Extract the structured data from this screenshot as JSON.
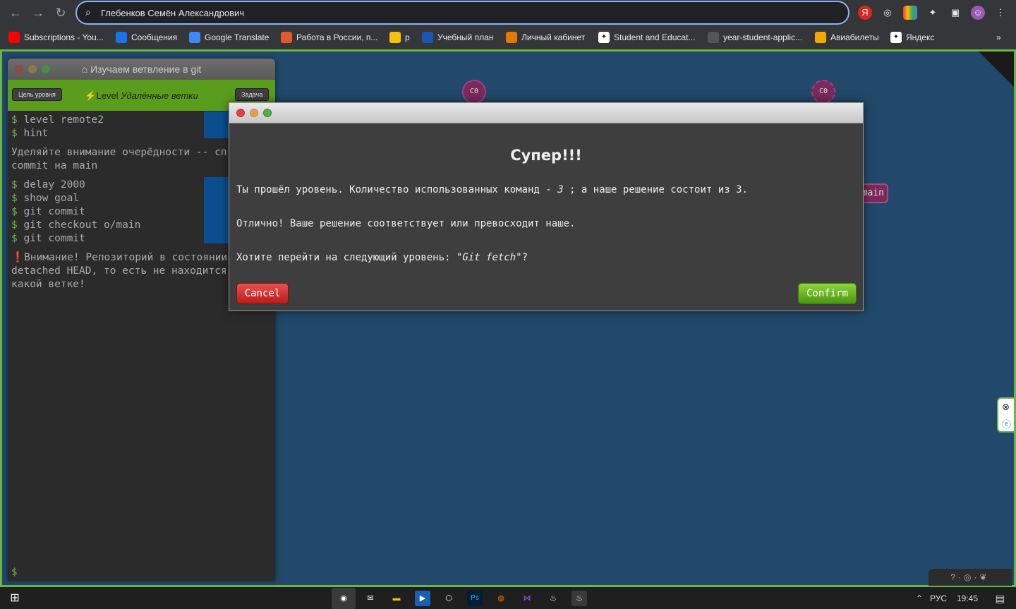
{
  "browser": {
    "url_text": "Глебенков Семён Александрович",
    "bookmarks": [
      {
        "label": "Subscriptions - You...",
        "icon": "youtube-icon",
        "color": "#ff0000"
      },
      {
        "label": "Сообщения",
        "icon": "messages-icon",
        "color": "#1a73e8"
      },
      {
        "label": "Google Translate",
        "icon": "translate-icon",
        "color": "#4285f4"
      },
      {
        "label": "Работа в России, п...",
        "icon": "work-icon",
        "color": "#e05a2b"
      },
      {
        "label": "p",
        "icon": "folder-icon",
        "color": "#f4c20d"
      },
      {
        "label": "Учебный план",
        "icon": "study-icon",
        "color": "#1a56b3"
      },
      {
        "label": "Личный кабинет",
        "icon": "cabinet-icon",
        "color": "#e07b00"
      },
      {
        "label": "Student and Educat...",
        "icon": "student-icon",
        "color": "#ffffff"
      },
      {
        "label": "year-student-applic...",
        "icon": "web-icon",
        "color": "#555555"
      },
      {
        "label": "Авиабилеты",
        "icon": "plane-icon",
        "color": "#f2a900"
      },
      {
        "label": "Яндекс",
        "icon": "yandex-icon",
        "color": "#ffffff"
      }
    ]
  },
  "terminal": {
    "title": "Изучаем ветвление в git",
    "goal_btn": "Цель уровня",
    "task_btn": "Задача",
    "level_prefix": "Level",
    "level_name": "Удалённые ветки",
    "lines1": [
      "level remote2",
      "hint"
    ],
    "hint_text_1": "Уделяйте внимание очерёдности -- сп",
    "hint_text_2": "commit на main",
    "lines2": [
      "delay 2000",
      "show goal",
      "git commit",
      "git checkout o/main",
      "git commit"
    ],
    "warn_1": "Внимание! Репозиторий в состоянии",
    "warn_2": "detached HEAD, то есть не находится",
    "warn_3": "какой ветке!",
    "prompt": "$"
  },
  "graph": {
    "node_left": "C0",
    "node_right": "C0",
    "branch": "main"
  },
  "dialog": {
    "title": "Супер!!!",
    "line1_a": "Ты прошёл уровень. Количество использованных команд - ",
    "line1_count": "3",
    "line1_b": " ; а наше решение состоит из 3.",
    "line2": "Отлично! Ваше решение соответствует или превосходит наше.",
    "line3_a": "Хотите перейти на следующий уровень: ",
    "line3_level": "\"Git fetch\"",
    "line3_b": "?",
    "cancel": "Cancel",
    "confirm": "Confirm"
  },
  "taskbar": {
    "lang": "РУС",
    "time": "19:45"
  }
}
